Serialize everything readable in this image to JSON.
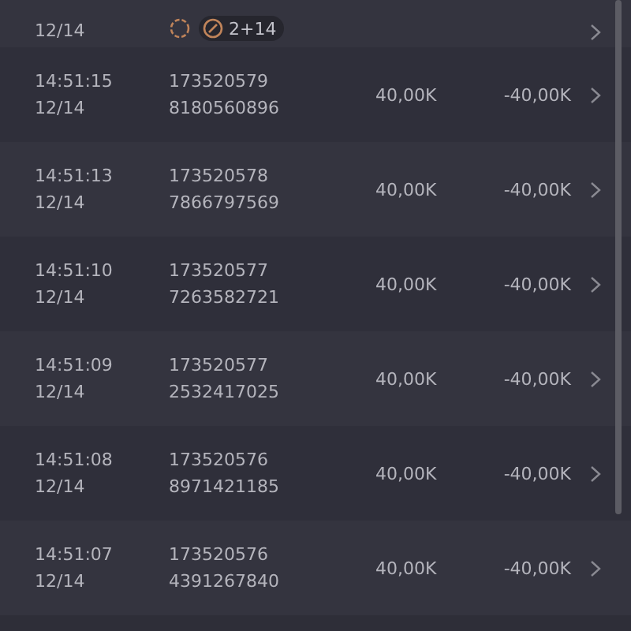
{
  "top_row": {
    "date": "12/14",
    "badge": "2+14"
  },
  "rows": [
    {
      "time": "14:51:15",
      "date": "12/14",
      "id_line_1": "173520579",
      "id_line_2": "8180560896",
      "amount": "40,00K",
      "change": "-40,00K"
    },
    {
      "time": "14:51:13",
      "date": "12/14",
      "id_line_1": "173520578",
      "id_line_2": "7866797569",
      "amount": "40,00K",
      "change": "-40,00K"
    },
    {
      "time": "14:51:10",
      "date": "12/14",
      "id_line_1": "173520577",
      "id_line_2": "7263582721",
      "amount": "40,00K",
      "change": "-40,00K"
    },
    {
      "time": "14:51:09",
      "date": "12/14",
      "id_line_1": "173520577",
      "id_line_2": "2532417025",
      "amount": "40,00K",
      "change": "-40,00K"
    },
    {
      "time": "14:51:08",
      "date": "12/14",
      "id_line_1": "173520576",
      "id_line_2": "8971421185",
      "amount": "40,00K",
      "change": "-40,00K"
    },
    {
      "time": "14:51:07",
      "date": "12/14",
      "id_line_1": "173520576",
      "id_line_2": "4391267840",
      "amount": "40,00K",
      "change": "-40,00K"
    }
  ]
}
